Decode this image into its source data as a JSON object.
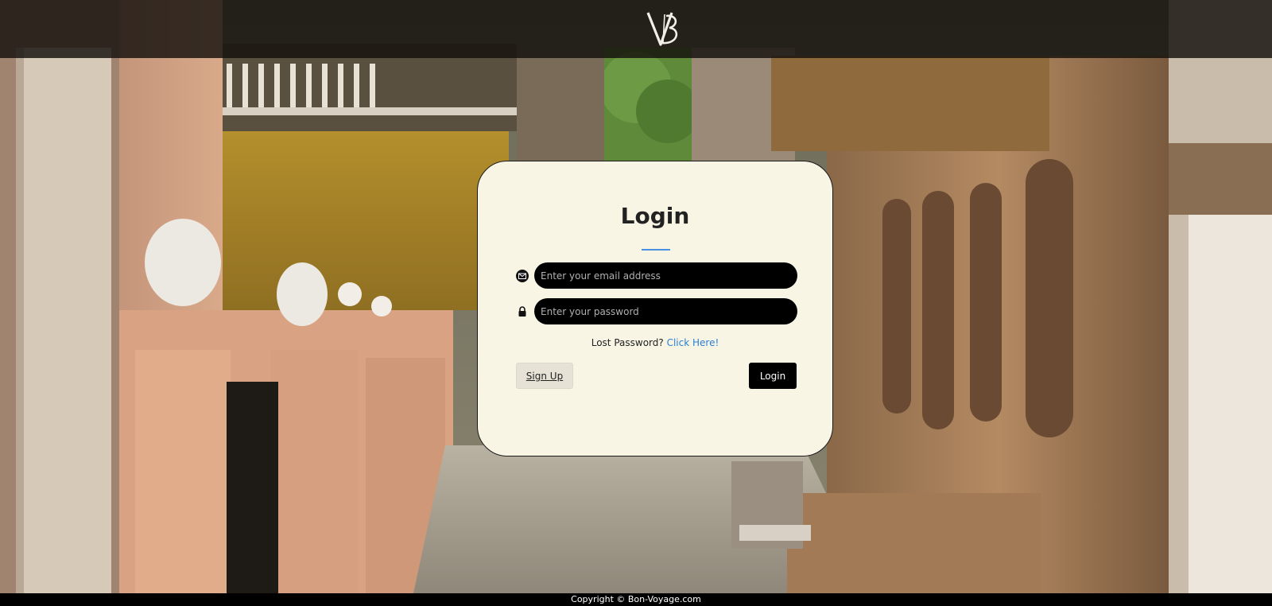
{
  "header": {
    "logo_icon": "vb-monogram-logo",
    "logo_text": "VB"
  },
  "login_card": {
    "title": "Login",
    "email_field": {
      "icon": "envelope-icon",
      "placeholder": "Enter your email address",
      "value": ""
    },
    "password_field": {
      "icon": "lock-icon",
      "placeholder": "Enter your password",
      "value": ""
    },
    "lost_password": {
      "text": "Lost Password?",
      "link_label": "Click Here!"
    },
    "signup_label": "Sign Up",
    "login_label": "Login"
  },
  "footer": {
    "copyright": "Copyright © Bon-Voyage.com"
  },
  "colors": {
    "card_background": "#f8f5e5",
    "input_background": "#000000",
    "link": "#2a7fd8",
    "underline_accent": "#4a90e2"
  }
}
